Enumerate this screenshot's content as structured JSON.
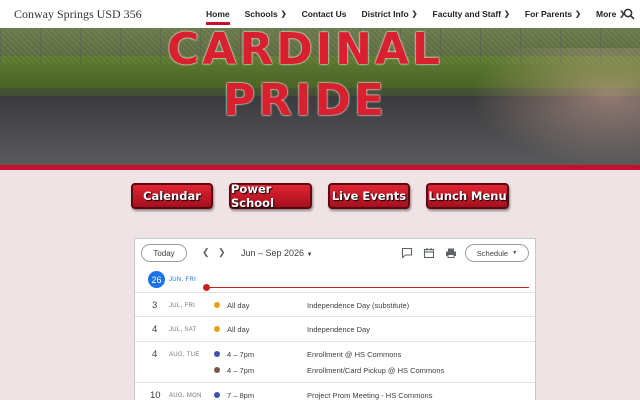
{
  "site": {
    "title": "Conway Springs USD 356"
  },
  "nav": {
    "items": [
      {
        "label": "Home",
        "active": true,
        "has_menu": false
      },
      {
        "label": "Schools",
        "active": false,
        "has_menu": true
      },
      {
        "label": "Contact Us",
        "active": false,
        "has_menu": false
      },
      {
        "label": "District Info",
        "active": false,
        "has_menu": true
      },
      {
        "label": "Faculty and Staff",
        "active": false,
        "has_menu": true
      },
      {
        "label": "For Parents",
        "active": false,
        "has_menu": true
      },
      {
        "label": "More",
        "active": false,
        "has_menu": true
      }
    ],
    "search_icon": "search-icon"
  },
  "hero": {
    "sign_text": "CARDINAL PRIDE"
  },
  "quick_links": [
    {
      "label": "Calendar"
    },
    {
      "label": "Power School"
    },
    {
      "label": "Live Events"
    },
    {
      "label": "Lunch Menu"
    }
  ],
  "calendar": {
    "today_label": "Today",
    "prev_icon": "chevron-left-icon",
    "next_icon": "chevron-right-icon",
    "date_range": "Jun – Sep 2026",
    "view_label": "Schedule",
    "toolbar_icons": [
      "feedback-icon",
      "calendar-icon",
      "print-icon"
    ],
    "today": {
      "day": "26",
      "label": "JUN, FRI"
    },
    "days": [
      {
        "day": "3",
        "label": "JUL, FRI",
        "events": [
          {
            "time": "All day",
            "title": "Independence Day (substitute)",
            "color": "#e3a21a"
          }
        ]
      },
      {
        "day": "4",
        "label": "JUL, SAT",
        "events": [
          {
            "time": "All day",
            "title": "Independence Day",
            "color": "#e3a21a"
          }
        ]
      },
      {
        "day": "4",
        "label": "AUG, TUE",
        "events": [
          {
            "time": "4 – 7pm",
            "title": "Enrollment @ HS Commons",
            "color": "#3f51b5"
          },
          {
            "time": "4 – 7pm",
            "title": "Enrollment/Card Pickup @ HS Commons",
            "color": "#795548"
          }
        ]
      },
      {
        "day": "10",
        "label": "AUG, MON",
        "events": [
          {
            "time": "7 – 8pm",
            "title": "Project Prom Meeting - HS Commons",
            "color": "#3f51b5"
          }
        ]
      }
    ]
  },
  "colors": {
    "accent": "#c8102e",
    "today_blue": "#1a73e8",
    "now_line": "#c5221f"
  }
}
